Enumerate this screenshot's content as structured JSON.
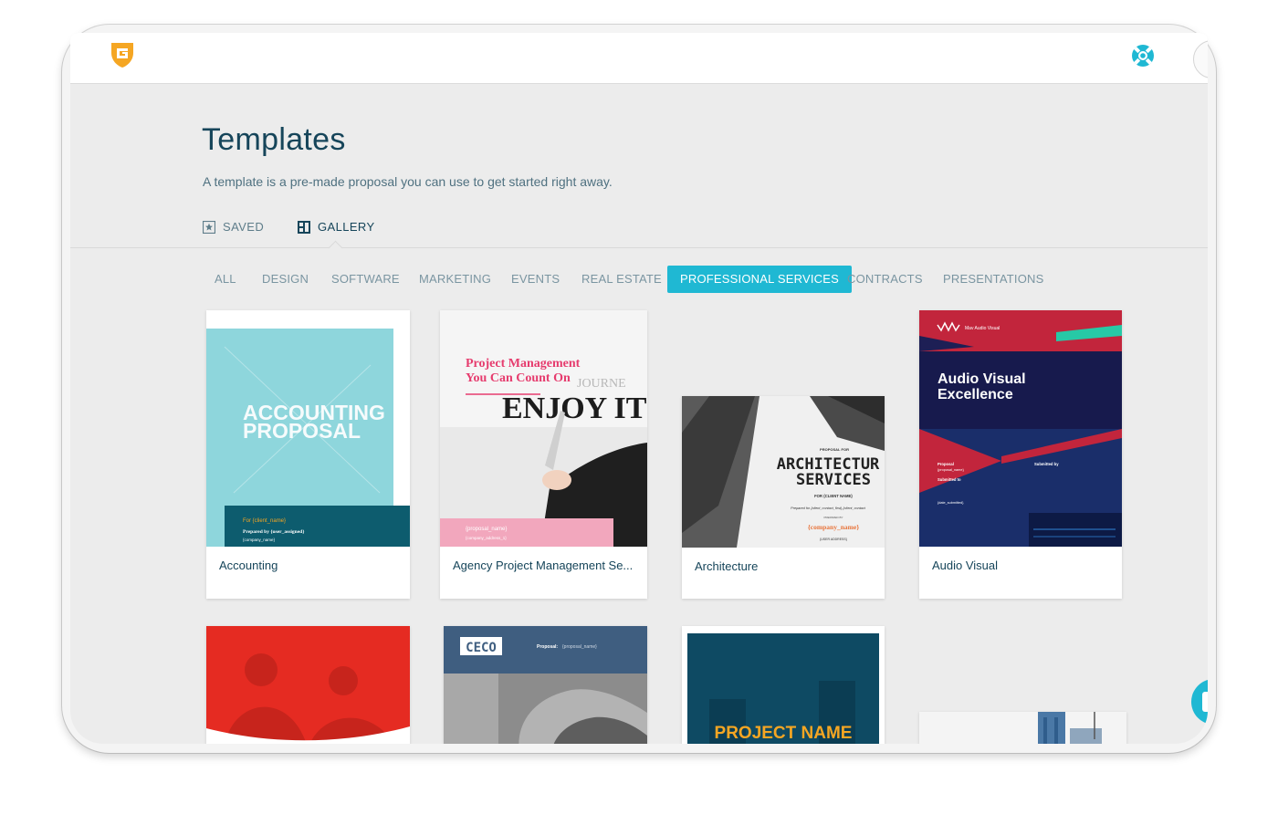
{
  "page": {
    "title": "Templates",
    "subtitle": "A template is a pre-made proposal you can use to get started right away."
  },
  "view_tabs": [
    {
      "label": "SAVED"
    },
    {
      "label": "GALLERY",
      "active": true
    }
  ],
  "categories": [
    {
      "label": "ALL"
    },
    {
      "label": "DESIGN"
    },
    {
      "label": "SOFTWARE"
    },
    {
      "label": "MARKETING"
    },
    {
      "label": "EVENTS"
    },
    {
      "label": "REAL ESTATE"
    },
    {
      "label": "PROFESSIONAL SERVICES",
      "active": true
    },
    {
      "label": "CONTRACTS"
    },
    {
      "label": "PRESENTATIONS"
    }
  ],
  "templates": [
    {
      "name": "Accounting",
      "cover": {
        "title_line1": "ACCOUNTING",
        "title_line2": "PROPOSAL",
        "for": "For {client_name}",
        "prepared": "Prepared by {user_assigned}",
        "company": "{company_name}"
      }
    },
    {
      "name": "Agency Project Management Se...",
      "cover": {
        "headline1": "Project Management",
        "headline2": "You Can Count On",
        "bg_text": "ENJOY IT",
        "bg_text2": "JOURNE",
        "proposal": "{proposal_name}",
        "company": "{company_address_1}"
      }
    },
    {
      "name": "Architecture",
      "cover": {
        "kicker": "PROPOSAL FOR",
        "title1": "ARCHITECTUR",
        "title2": "SERVICES",
        "for": "FOR {CLIENT NAME}",
        "prepared": "Prepared for {client_contact_first} {client_contact",
        "prepared_by": "PREPARED BY",
        "company": "{company_name}",
        "address": "{USER ADDRESS}"
      }
    },
    {
      "name": "Audio Visual",
      "cover": {
        "brand": "Mav Audio Visual",
        "title1": "Audio Visual",
        "title2": "Excellence",
        "proposal_label": "Proposal",
        "proposal_value": "{proposal_name}",
        "submitted_to": "Submitted to",
        "submitted_by": "Submitted by",
        "date": "{date_submitted}"
      }
    },
    {
      "name": "",
      "cover": {}
    },
    {
      "name": "",
      "cover": {
        "logo": "CECO",
        "proposal_label": "Proposal:",
        "proposal_value": "{proposal_name}"
      }
    },
    {
      "name": "",
      "cover": {
        "title": "PROJECT NAME"
      }
    },
    {
      "name": "",
      "cover": {}
    }
  ],
  "colors": {
    "accent": "#1fb8d3",
    "title": "#16455a",
    "logo": "#f5a623",
    "background": "#ececec"
  },
  "icons": {
    "logo": "shield-g-logo",
    "help": "lifebuoy-icon",
    "saved": "star-box-icon",
    "gallery": "gallery-icon"
  }
}
